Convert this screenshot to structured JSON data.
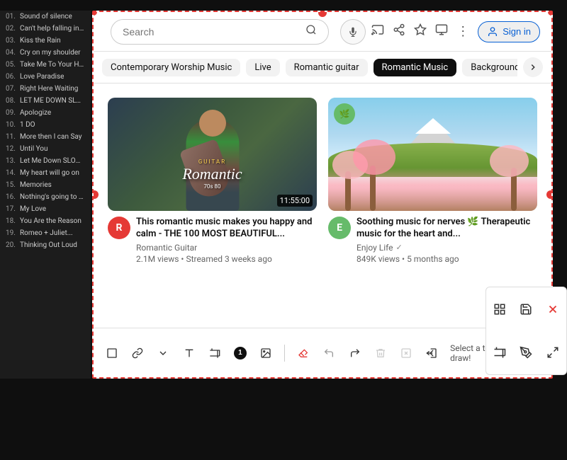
{
  "page": {
    "background_color": "#111"
  },
  "header": {
    "search_placeholder": "Search",
    "search_value": "",
    "menu_icon": "⋮",
    "sign_in_label": "Sign in"
  },
  "filter_chips": [
    {
      "label": "Contemporary Worship Music",
      "active": false
    },
    {
      "label": "Live",
      "active": false
    },
    {
      "label": "Romantic guitar",
      "active": false
    },
    {
      "label": "Romantic Music",
      "active": true
    },
    {
      "label": "Background music",
      "active": false
    }
  ],
  "videos": [
    {
      "title": "This romantic music makes you happy and calm - THE 100 MOST BEAUTIFUL...",
      "channel": "Romantic Guitar",
      "views": "2.1M views",
      "time": "Streamed 3 weeks ago",
      "duration": "11:55:00",
      "verified": false
    },
    {
      "title": "Soothing music for nerves 🌿 Therapeutic music for the heart and...",
      "channel": "Enjoy Life",
      "views": "849K views",
      "time": "5 months ago",
      "duration": "",
      "verified": true
    }
  ],
  "playlist": [
    "Sound of silence",
    "Can't help falling in love",
    "Kiss the Rain",
    "Cry on my shoulder",
    "Take Me To Your Heart",
    "Love Paradise",
    "Right Here Waiting",
    "LET ME DOWN SLOWly...",
    "Apologize",
    "1 DO",
    "More then I can Say",
    "Until You",
    "Let Me Down SLOWLY, Pixell",
    "My heart will go on",
    "Memories",
    "Nothing's going to change...",
    "My Love",
    "You Are the Reason",
    "Romeo + Juliet...",
    "Thinking Out Loud"
  ],
  "toolbar": {
    "tools": [
      {
        "name": "rectangle-tool",
        "icon": "▭",
        "active": false
      },
      {
        "name": "link-tool",
        "icon": "🔗",
        "active": false
      },
      {
        "name": "dropdown-tool",
        "icon": "▾",
        "active": false
      },
      {
        "name": "text-tool",
        "icon": "T",
        "active": false
      },
      {
        "name": "crop-tool",
        "icon": "⊞",
        "active": false
      },
      {
        "name": "badge-1",
        "icon": "1",
        "active": false
      },
      {
        "name": "image-tool",
        "icon": "🖼",
        "active": false
      }
    ],
    "instruction": "Select a tool to start to draw!"
  },
  "right_toolbar": {
    "buttons": [
      {
        "name": "grid-btn",
        "icon": "⊞"
      },
      {
        "name": "save-btn",
        "icon": "💾"
      },
      {
        "name": "close-btn",
        "icon": "✕"
      },
      {
        "name": "crop2-btn",
        "icon": "⊡"
      },
      {
        "name": "pen-btn",
        "icon": "✏"
      },
      {
        "name": "fullscreen-btn",
        "icon": "⛶"
      }
    ]
  }
}
